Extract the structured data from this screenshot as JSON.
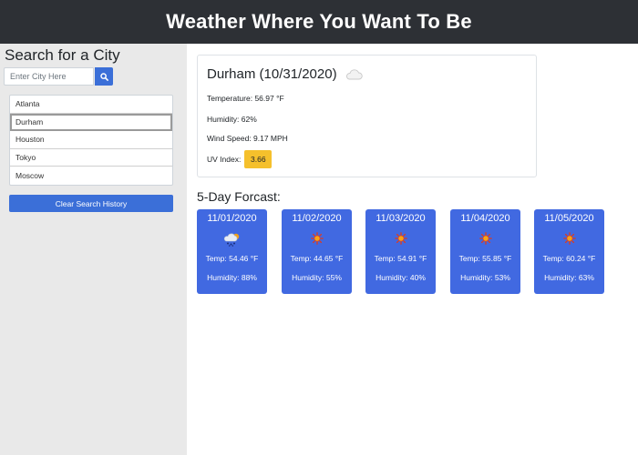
{
  "header": {
    "title": "Weather Where You Want To Be"
  },
  "sidebar": {
    "heading": "Search for a City",
    "search": {
      "placeholder": "Enter City Here",
      "value": ""
    },
    "search_button_icon": "search-icon",
    "history": [
      "Atlanta",
      "Durham",
      "Houston",
      "Tokyo",
      "Moscow"
    ],
    "selected_city": "Durham",
    "clear_label": "Clear Search History"
  },
  "current": {
    "city_title": "Durham (10/31/2020)",
    "icon": "cloud-icon",
    "temperature": "Temperature: 56.97 °F",
    "humidity": "Humidity: 62%",
    "wind": "Wind Speed: 9.17 MPH",
    "uv_label": "UV Index:",
    "uv_value": "3.66"
  },
  "forecast": {
    "title": "5-Day Forcast:",
    "days": [
      {
        "date": "11/01/2020",
        "icon": "rain-snow-icon",
        "temp": "Temp: 54.46 °F",
        "humidity": "Humidity: 88%"
      },
      {
        "date": "11/02/2020",
        "icon": "sun-icon",
        "temp": "Temp: 44.65 °F",
        "humidity": "Humidity: 55%"
      },
      {
        "date": "11/03/2020",
        "icon": "sun-icon",
        "temp": "Temp: 54.91 °F",
        "humidity": "Humidity: 40%"
      },
      {
        "date": "11/04/2020",
        "icon": "sun-icon",
        "temp": "Temp: 55.85 °F",
        "humidity": "Humidity: 53%"
      },
      {
        "date": "11/05/2020",
        "icon": "sun-icon",
        "temp": "Temp: 60.24 °F",
        "humidity": "Humidity: 63%"
      }
    ]
  },
  "colors": {
    "header_bg": "#2d3035",
    "accent": "#3b6fd8",
    "card_bg": "#4169e1",
    "uv_badge": "#f5c02c"
  }
}
